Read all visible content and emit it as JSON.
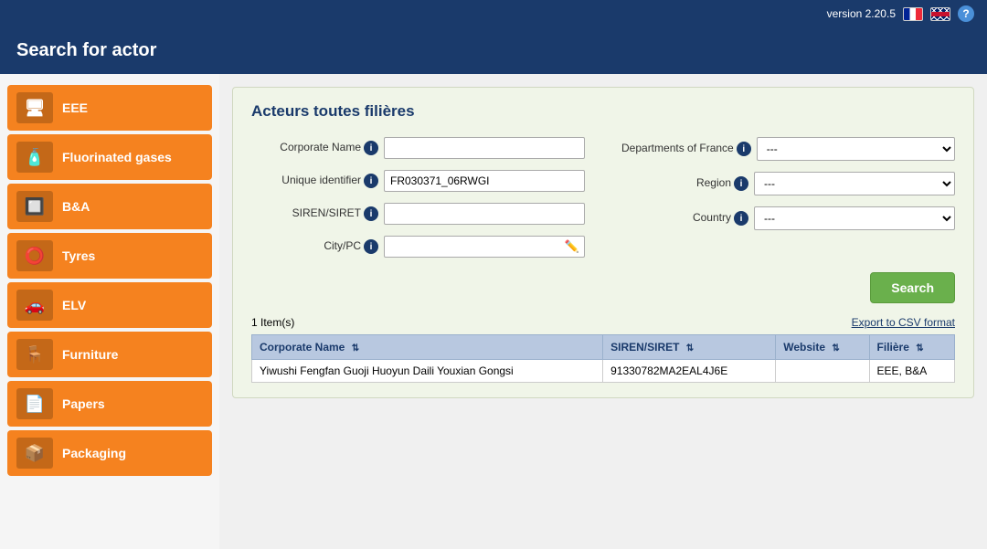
{
  "topbar": {
    "version": "version 2.20.5",
    "help_label": "?"
  },
  "header": {
    "title": "Search for actor"
  },
  "sidebar": {
    "items": [
      {
        "id": "eee",
        "label": "EEE",
        "icon": "🖥"
      },
      {
        "id": "fluorinated",
        "label": "Fluorinated gases",
        "icon": "🧴"
      },
      {
        "id": "bna",
        "label": "B&A",
        "icon": "🔲"
      },
      {
        "id": "tyres",
        "label": "Tyres",
        "icon": "⭕"
      },
      {
        "id": "elv",
        "label": "ELV",
        "icon": "🚗"
      },
      {
        "id": "furniture",
        "label": "Furniture",
        "icon": "🪑"
      },
      {
        "id": "papers",
        "label": "Papers",
        "icon": "📄"
      },
      {
        "id": "packaging",
        "label": "Packaging",
        "icon": "📦"
      }
    ]
  },
  "panel": {
    "title": "Acteurs toutes filières",
    "form": {
      "corporate_name_label": "Corporate Name",
      "unique_identifier_label": "Unique identifier",
      "siren_siret_label": "SIREN/SIRET",
      "city_pc_label": "City/PC",
      "departments_label": "Departments of France",
      "region_label": "Region",
      "country_label": "Country",
      "corporate_name_value": "",
      "unique_identifier_value": "FR030371_06RWGI",
      "siren_siret_value": "",
      "city_pc_value": "",
      "departments_default": "---",
      "region_default": "---",
      "country_default": "---",
      "departments_options": [
        "---"
      ],
      "region_options": [
        "---"
      ],
      "country_options": [
        "---"
      ]
    },
    "search_button": "Search",
    "export_label": "Export to CSV format",
    "results_count": "1 Item(s)",
    "table": {
      "headers": [
        {
          "id": "corporate_name",
          "label": "Corporate Name"
        },
        {
          "id": "siren_siret",
          "label": "SIREN/SIRET"
        },
        {
          "id": "website",
          "label": "Website"
        },
        {
          "id": "filiere",
          "label": "Filière"
        }
      ],
      "rows": [
        {
          "corporate_name": "Yiwushi Fengfan Guoji Huoyun Daili Youxian Gongsi",
          "siren_siret": "91330782MA2EAL4J6E",
          "website": "",
          "filiere": "EEE, B&A"
        }
      ]
    }
  }
}
